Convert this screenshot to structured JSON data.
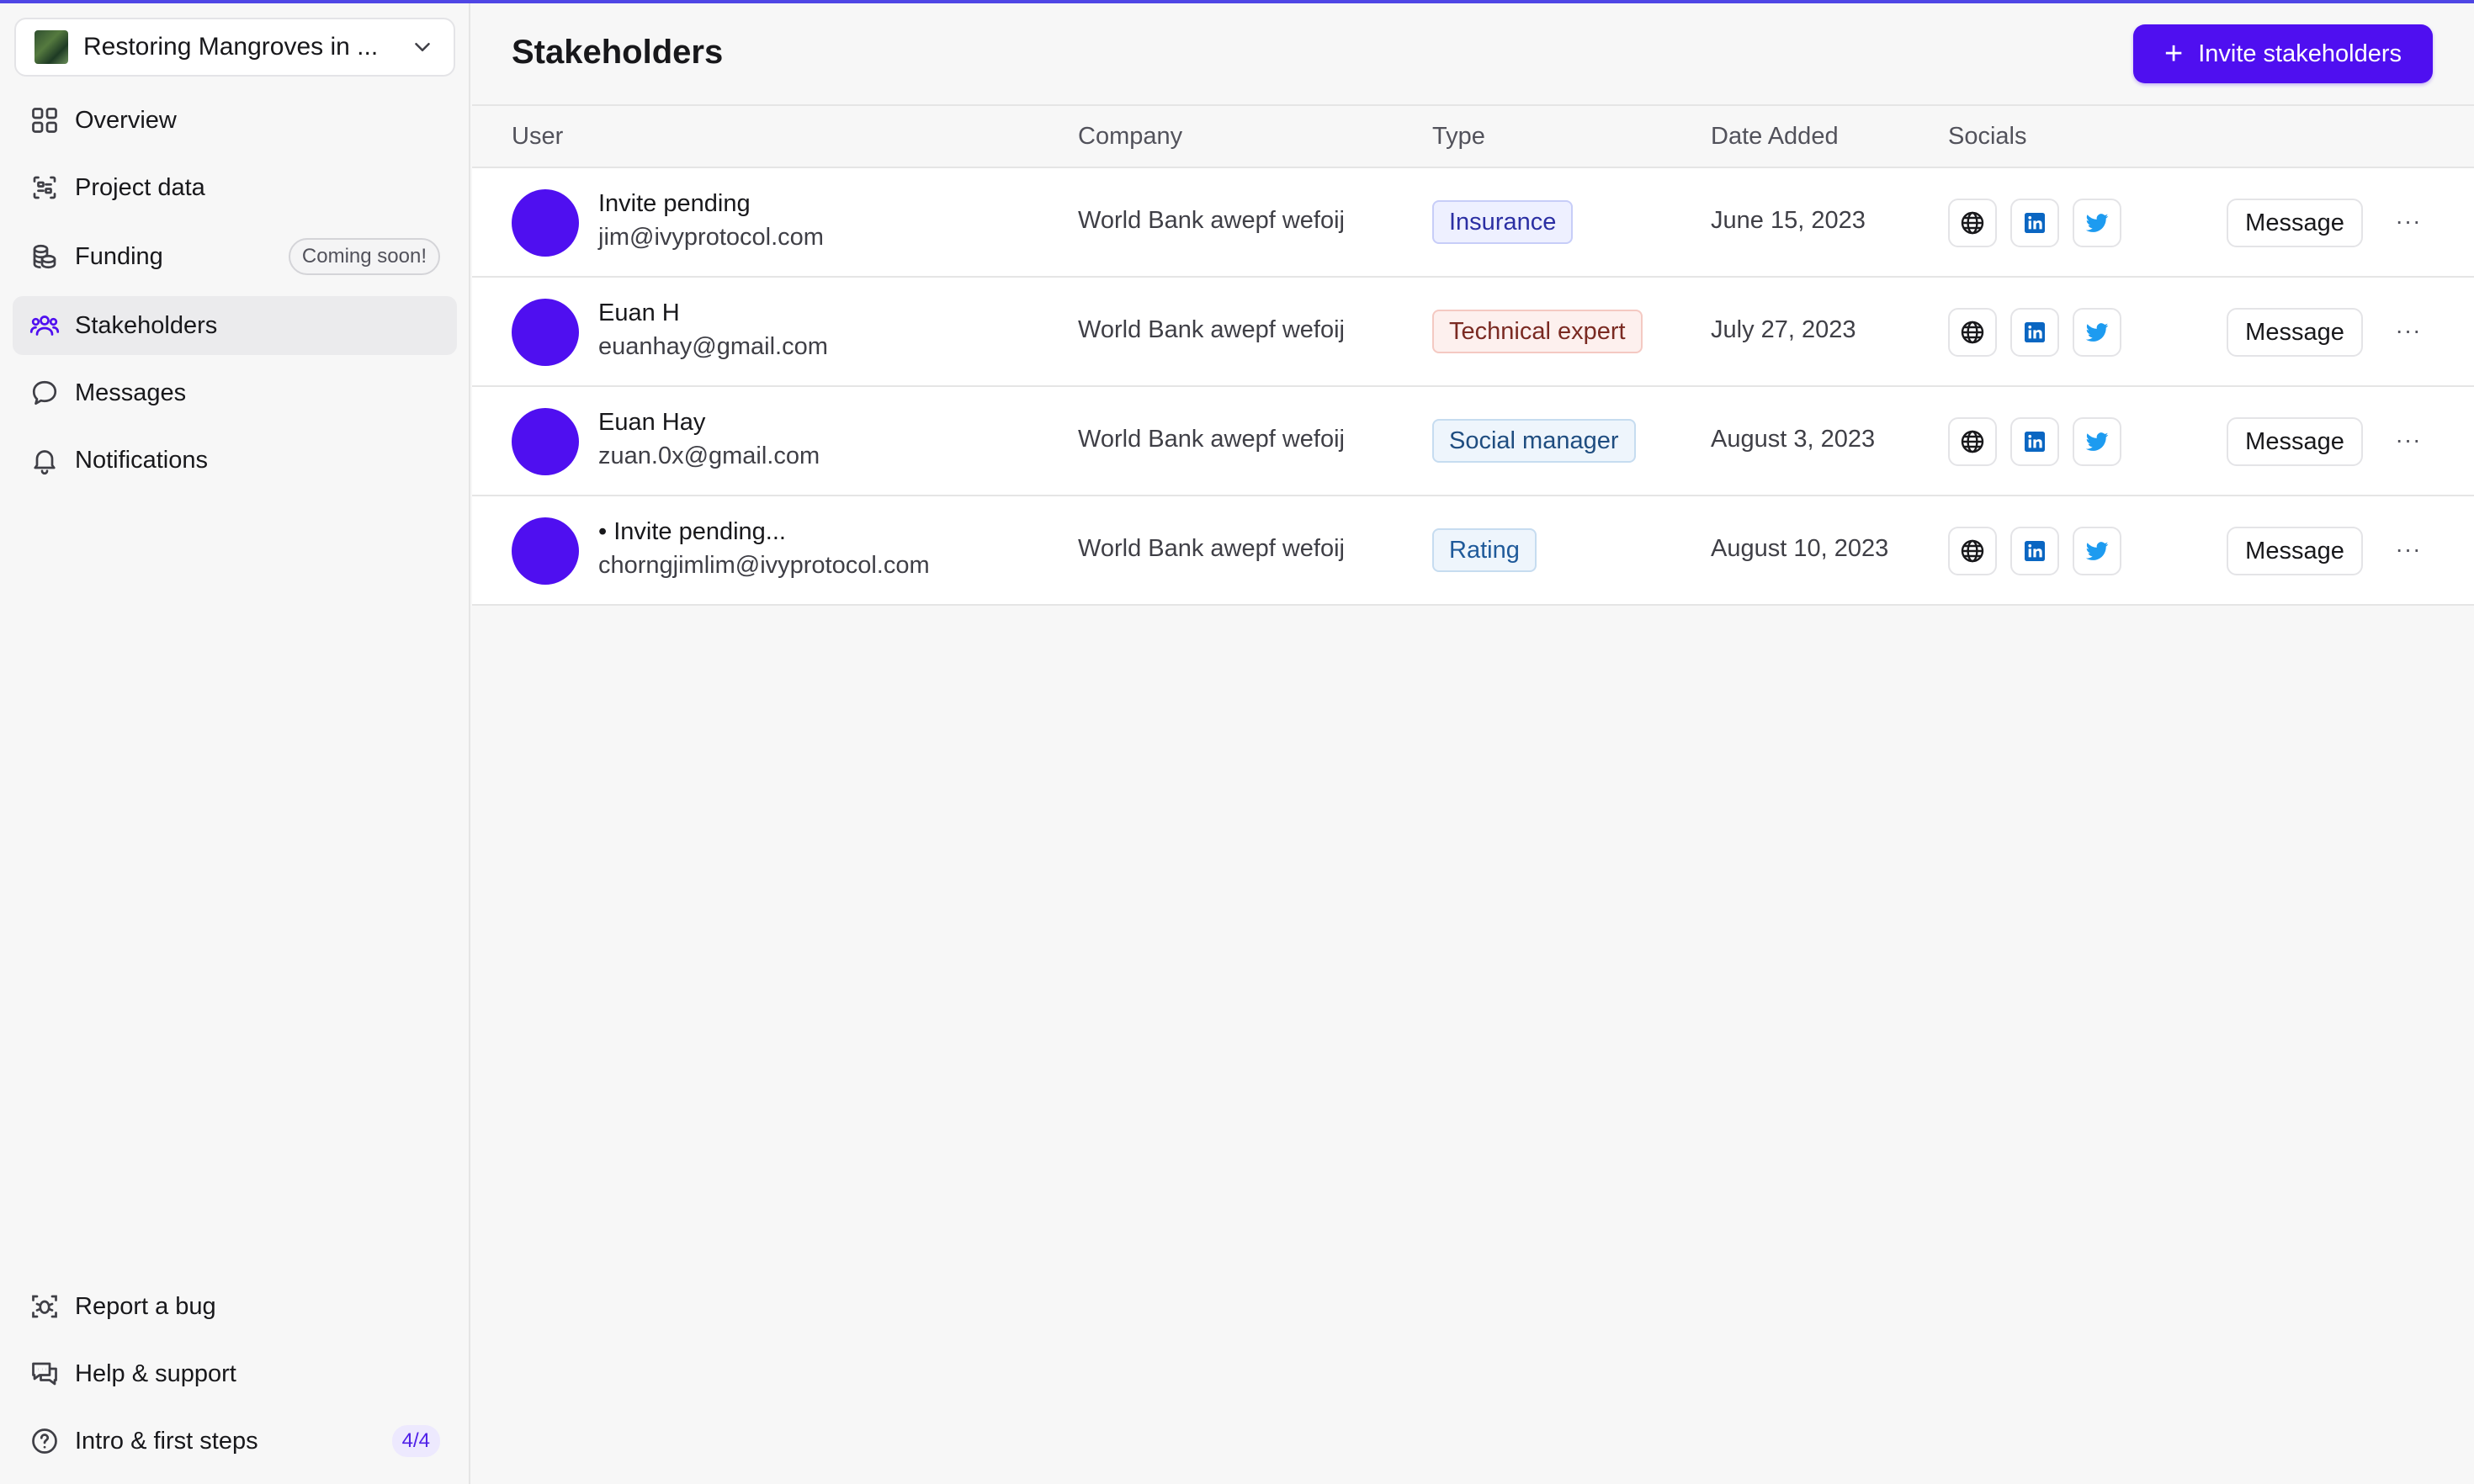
{
  "sidebar": {
    "project_name": "Restoring Mangroves in ...",
    "nav": [
      {
        "label": "Overview",
        "icon": "grid-icon"
      },
      {
        "label": "Project data",
        "icon": "database-icon"
      },
      {
        "label": "Funding",
        "icon": "coins-icon",
        "badge": "Coming soon!"
      },
      {
        "label": "Stakeholders",
        "icon": "users-icon",
        "active": true
      },
      {
        "label": "Messages",
        "icon": "chat-icon"
      },
      {
        "label": "Notifications",
        "icon": "bell-icon"
      }
    ],
    "footer": [
      {
        "label": "Report a bug",
        "icon": "bug-icon"
      },
      {
        "label": "Help & support",
        "icon": "support-icon"
      },
      {
        "label": "Intro & first steps",
        "icon": "question-icon",
        "badge": "4/4"
      }
    ]
  },
  "header": {
    "title": "Stakeholders",
    "invite_label": "Invite stakeholders"
  },
  "table": {
    "columns": {
      "user": "User",
      "company": "Company",
      "type": "Type",
      "date": "Date Added",
      "socials": "Socials"
    },
    "rows": [
      {
        "name": "Invite pending",
        "email": "jim@ivyprotocol.com",
        "company": "World Bank awepf wefoij",
        "type": "Insurance",
        "date": "June 15, 2023",
        "message": "Message"
      },
      {
        "name": "Euan H",
        "email": "euanhay@gmail.com",
        "company": "World Bank awepf wefoij",
        "type": "Technical expert",
        "date": "July 27, 2023",
        "message": "Message"
      },
      {
        "name": "Euan Hay",
        "email": "zuan.0x@gmail.com",
        "company": "World Bank awepf wefoij",
        "type": "Social manager",
        "date": "August 3, 2023",
        "message": "Message"
      },
      {
        "name": "• Invite pending...",
        "email": "chorngjimlim@ivyprotocol.com",
        "company": "World Bank awepf wefoij",
        "type": "Rating",
        "date": "August 10, 2023",
        "message": "Message"
      }
    ],
    "more_glyph": "···"
  },
  "colors": {
    "accent": "#4f0ff0",
    "topline": "#4f46e5",
    "linkedin": "#0a66c2",
    "twitter": "#1d9bf0"
  }
}
